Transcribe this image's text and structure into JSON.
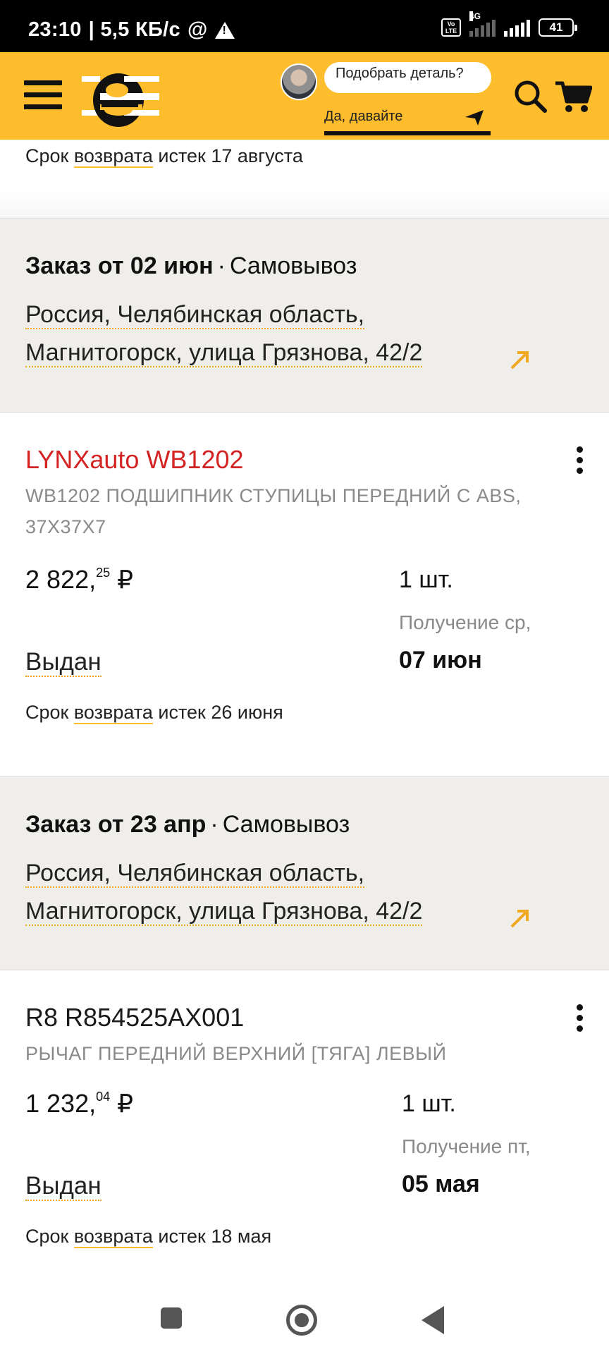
{
  "status_bar": {
    "time": "23:10",
    "speed": "| 5,5 КБ/с",
    "at": "@",
    "volte": "Vo LTE",
    "network": "4G",
    "battery": "41"
  },
  "header": {
    "logo": "e",
    "chat_prompt": "Подобрать деталь?",
    "chat_action": "Да, давайте",
    "icons": [
      "menu-icon",
      "search-icon",
      "cart-icon",
      "send-icon"
    ],
    "brand_color": "#fdbd2c"
  },
  "top_partial": {
    "return_prefix": "Срок",
    "return_link": "возврата",
    "return_suffix": "истек 17 августа"
  },
  "orders": [
    {
      "title": "Заказ от 02 июн",
      "delivery": "Самовывоз",
      "address_line1": "Россия, Челябинская область,",
      "address_line2": "Магнитогорск, улица Грязнова, 42/2",
      "item": {
        "brand": "LYNXauto WB1202",
        "description": "WB1202 ПОДШИПНИК СТУПИЦЫ ПЕРЕДНИЙ С ABS, 37X37X7",
        "price_main": "2 822,",
        "price_cents": "25",
        "currency": "₽",
        "qty": "1 шт.",
        "receive_label": "Получение ср,",
        "receive_date": "07 июн",
        "status": "Выдан",
        "return_prefix": "Срок",
        "return_link": "возврата",
        "return_suffix": "истек 26 июня"
      }
    },
    {
      "title": "Заказ от 23 апр",
      "delivery": "Самовывоз",
      "address_line1": "Россия, Челябинская область,",
      "address_line2": "Магнитогорск, улица Грязнова, 42/2",
      "item": {
        "brand": "R8 R854525AX001",
        "description": "РЫЧАГ ПЕРЕДНИЙ ВЕРХНИЙ [ТЯГА] ЛЕВЫЙ",
        "price_main": "1 232,",
        "price_cents": "04",
        "currency": "₽",
        "qty": "1 шт.",
        "receive_label": "Получение пт,",
        "receive_date": "05 мая",
        "status": "Выдан",
        "return_prefix": "Срок",
        "return_link": "возврата",
        "return_suffix": "истек 18 мая"
      }
    }
  ]
}
